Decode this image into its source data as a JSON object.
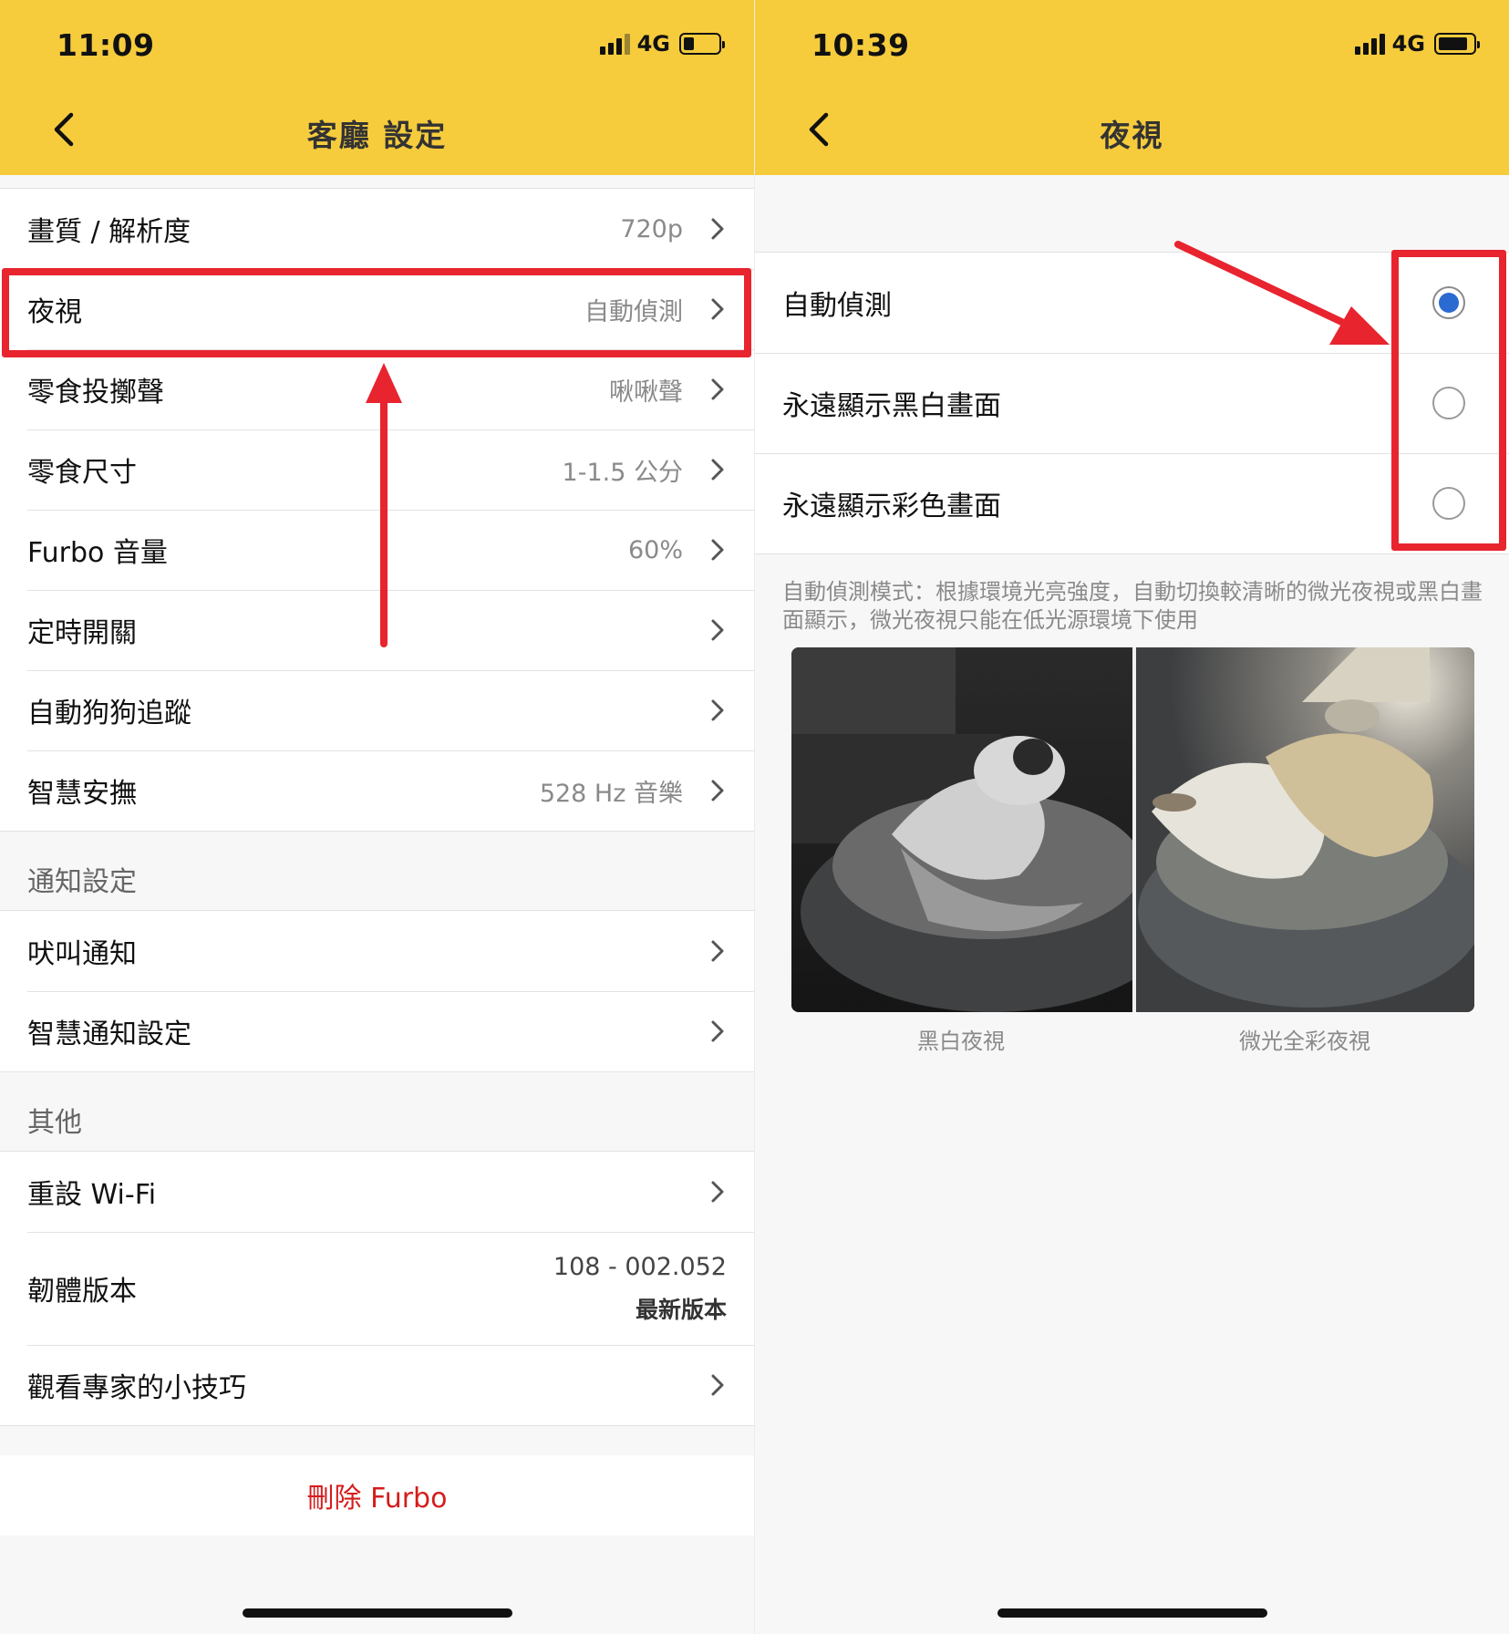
{
  "left": {
    "status": {
      "time": "11:09",
      "network": "4G",
      "battery_level": 0.3
    },
    "title": "客廳 設定",
    "rows": [
      {
        "label": "畫質 / 解析度",
        "value": "720p"
      },
      {
        "label": "夜視",
        "value": "自動偵測"
      },
      {
        "label": "零食投擲聲",
        "value": "啾啾聲"
      },
      {
        "label": "零食尺寸",
        "value": "1-1.5 公分"
      },
      {
        "label": "Furbo 音量",
        "value": "60%"
      },
      {
        "label": "定時開關",
        "value": ""
      },
      {
        "label": "自動狗狗追蹤",
        "value": ""
      },
      {
        "label": "智慧安撫",
        "value": "528 Hz 音樂"
      }
    ],
    "notify_section": "通知設定",
    "notify_rows": [
      {
        "label": "吠叫通知"
      },
      {
        "label": "智慧通知設定"
      }
    ],
    "other_section": "其他",
    "reset_wifi": "重設 Wi-Fi",
    "firmware": {
      "label": "韌體版本",
      "version": "108 - 002.052",
      "status": "最新版本"
    },
    "tips": "觀看專家的小技巧",
    "delete": "刪除 Furbo"
  },
  "right": {
    "status": {
      "time": "10:39",
      "network": "4G",
      "battery_level": 0.85
    },
    "title": "夜視",
    "options": [
      {
        "label": "自動偵測",
        "selected": true
      },
      {
        "label": "永遠顯示黑白畫面",
        "selected": false
      },
      {
        "label": "永遠顯示彩色畫面",
        "selected": false
      }
    ],
    "description": "自動偵測模式：根據環境光亮強度，自動切換較清晰的微光夜視或黑白畫面顯示，微光夜視只能在低光源環境下使用",
    "captions": {
      "bw": "黑白夜視",
      "color": "微光全彩夜視"
    }
  },
  "colors": {
    "header": "#f6cc3d",
    "annotation": "#e8242f",
    "radio_selected": "#2b6bd1",
    "delete": "#d51c1c"
  }
}
